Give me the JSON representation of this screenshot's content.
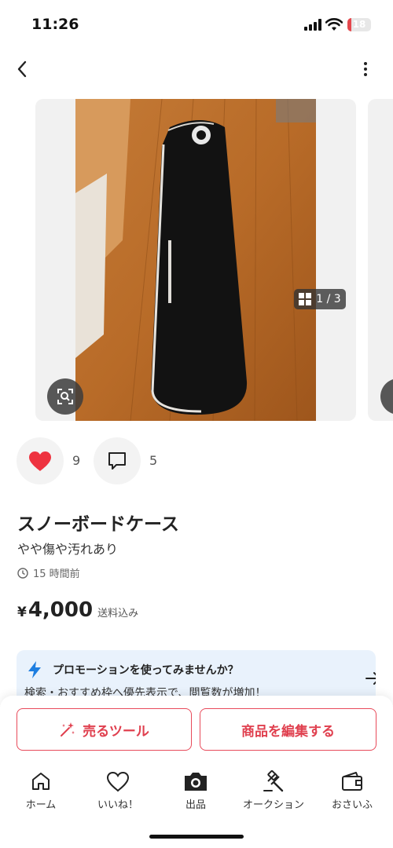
{
  "status_bar": {
    "time": "11:26",
    "battery": "18",
    "battery_level": 0.18
  },
  "carousel": {
    "counter": "1 / 3"
  },
  "reactions": {
    "likes": "9",
    "comments": "5"
  },
  "product": {
    "title": "スノーボードケース",
    "subtitle": "やや傷や汚れあり",
    "posted": "15 時間前",
    "price_symbol": "¥",
    "price": "4,000",
    "shipping": "送料込み"
  },
  "promo": {
    "title": "プロモーションを使ってみませんか？",
    "description": "検索・おすすめ枠へ優先表示で、閲覧数が増加！"
  },
  "actions": {
    "sell_tool": "売るツール",
    "edit_item": "商品を編集する"
  },
  "tabbar": {
    "home": "ホーム",
    "likes": "いいね！",
    "listing": "出品",
    "auction": "オークション",
    "wallet": "おさいふ"
  },
  "colors": {
    "accent": "#e84a5a",
    "heart": "#ee3340",
    "promo_bg": "#e9f2fc",
    "bolt": "#1e7ee0"
  },
  "icons": [
    "back-icon",
    "more-icon",
    "lens-search-icon",
    "grid-icon",
    "heart-icon",
    "comment-icon",
    "clock-icon",
    "bolt-icon",
    "arrow-right-icon",
    "sparkle-wand-icon",
    "home-icon",
    "heart-outline-icon",
    "camera-icon",
    "gavel-icon",
    "wallet-icon"
  ]
}
